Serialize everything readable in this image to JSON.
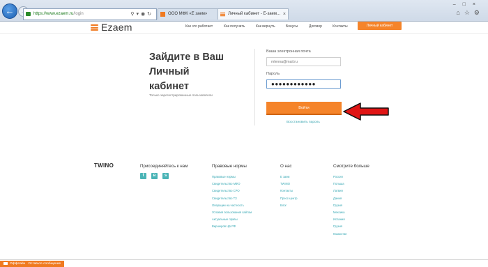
{
  "browser": {
    "url_main": "https://www.ezaem.ru",
    "url_rest": "/login",
    "tabs": [
      {
        "label": "ООО МФК «Е заем»"
      },
      {
        "label": "Личный кабинет - Е-заем..."
      }
    ]
  },
  "header": {
    "logo_text": "Ezaem",
    "nav": [
      "Как это работает",
      "Как получить",
      "Как вернуть",
      "Бонусы",
      "Договор",
      "Контакты"
    ],
    "cabinet_label": "Личный кабинет"
  },
  "login": {
    "title_lines": [
      "Зайдите в Ваш",
      "Личный",
      "кабинет"
    ],
    "subtitle": "Только зарегистрированные пользователи",
    "email_label": "Ваша электронная почта",
    "email_value": "mlenna@mail.ru",
    "password_label": "Пароль",
    "password_value": "●●●●●●●●●●●●",
    "submit_label": "Войти",
    "restore_label": "Восстановить пароль"
  },
  "footer": {
    "logo": "TWINO",
    "join_title": "Присоединяйтесь к нам",
    "social": [
      "f",
      "vk",
      "s"
    ],
    "legal_title": "Правовые нормы",
    "legal_items": [
      "Правовые нормы",
      "Свидетельство МФО",
      "Свидетельство СРО",
      "Свидетельство ТЗ",
      "Операции на частность",
      "Условия пользования сайтом",
      "Актуальные правы",
      "Виршеров ЦБ РФ"
    ],
    "about_title": "О нас",
    "about_items": [
      "Е заем",
      "TWINO",
      "Контакты",
      "Пресс-центр",
      "Блог"
    ],
    "more_title": "Смотрите больше",
    "more_items": [
      "Россия",
      "Польша",
      "Латвия",
      "Дания",
      "Грузия",
      "Мексика",
      "Испания",
      "Грузия",
      "Казахстан"
    ]
  },
  "chat": {
    "status": "Оффлайн",
    "action": "Оставьте сообщение"
  },
  "colors": {
    "accent": "#f5842a",
    "link": "#35a7b3",
    "arrow": "#e01515"
  }
}
